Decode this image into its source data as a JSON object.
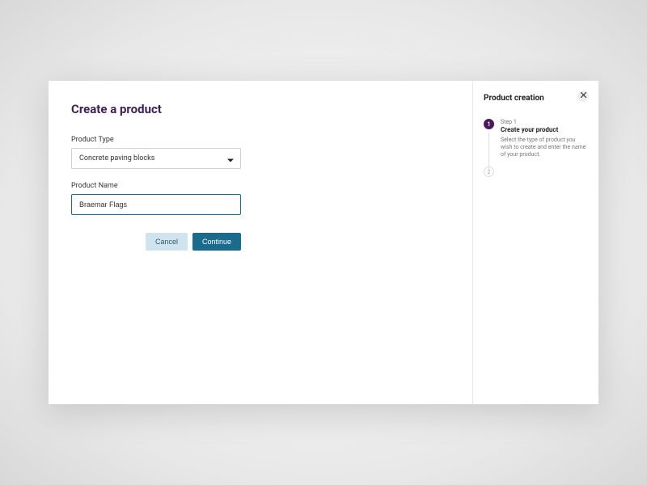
{
  "header": {
    "title": "Create a product"
  },
  "form": {
    "productType": {
      "label": "Product Type",
      "value": "Concrete paving blocks"
    },
    "productName": {
      "label": "Product Name",
      "value": "Braemar Flags"
    }
  },
  "actions": {
    "cancel": "Cancel",
    "continue": "Continue"
  },
  "sidebar": {
    "title": "Product creation",
    "steps": [
      {
        "number": "1",
        "label": "Step 1",
        "title": "Create your product",
        "description": "Select the type of product you wish to create and enter the name of your product."
      },
      {
        "number": "2"
      }
    ]
  },
  "colors": {
    "brand": "#3d1e56",
    "primary": "#1b6b8c",
    "secondary": "#cfe4ee"
  }
}
